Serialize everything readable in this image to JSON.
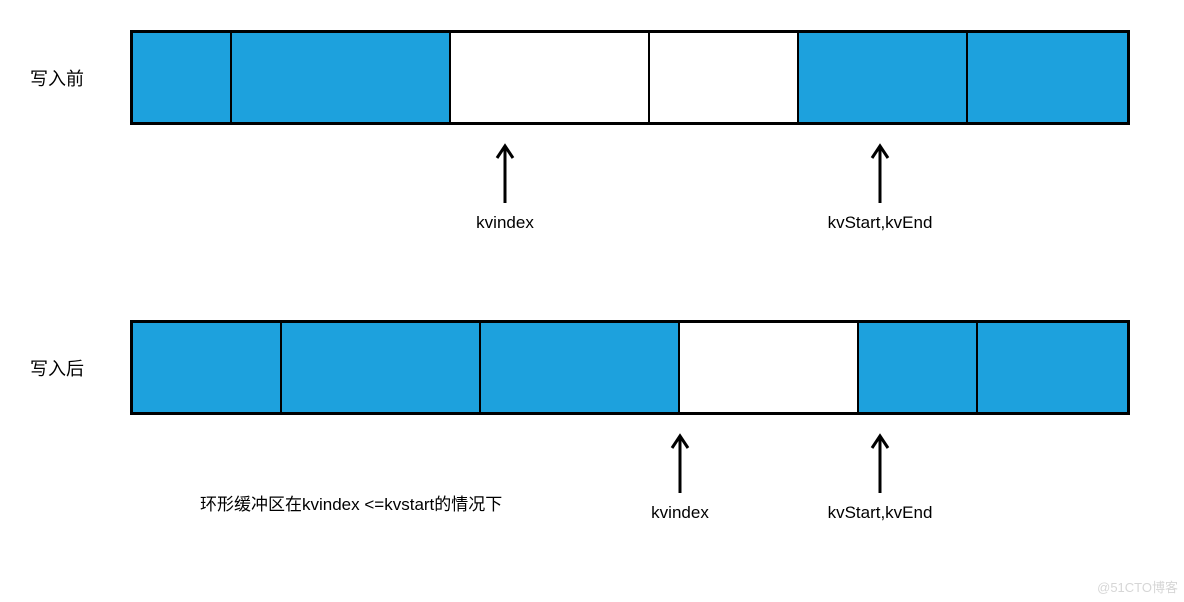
{
  "chart_data": {
    "type": "table",
    "buffers": [
      {
        "state": "before",
        "label": "写入前",
        "segments": [
          {
            "filled": true,
            "width_pct": 10
          },
          {
            "filled": true,
            "width_pct": 22
          },
          {
            "filled": false,
            "width_pct": 20
          },
          {
            "filled": false,
            "width_pct": 15
          },
          {
            "filled": true,
            "width_pct": 17
          },
          {
            "filled": true,
            "width_pct": 16
          }
        ],
        "pointers": [
          {
            "name": "kvindex",
            "position_pct": 38
          },
          {
            "name": "kvStart,kvEnd",
            "position_pct": 75
          }
        ]
      },
      {
        "state": "after",
        "label": "写入后",
        "segments": [
          {
            "filled": true,
            "width_pct": 15
          },
          {
            "filled": true,
            "width_pct": 20
          },
          {
            "filled": true,
            "width_pct": 20
          },
          {
            "filled": false,
            "width_pct": 18
          },
          {
            "filled": true,
            "width_pct": 12
          },
          {
            "filled": true,
            "width_pct": 15
          }
        ],
        "pointers": [
          {
            "name": "kvindex",
            "position_pct": 55
          },
          {
            "name": "kvStart,kvEnd",
            "position_pct": 75
          }
        ]
      }
    ],
    "caption": "环形缓冲区在kvindex <=kvstart的情况下"
  },
  "labels": {
    "before": "写入前",
    "after": "写入后",
    "kvindex_before": "kvindex",
    "kvstart_before": "kvStart,kvEnd",
    "kvindex_after": "kvindex",
    "kvstart_after": "kvStart,kvEnd",
    "caption": "环形缓冲区在kvindex <=kvstart的情况下",
    "watermark": "@51CTO博客"
  }
}
